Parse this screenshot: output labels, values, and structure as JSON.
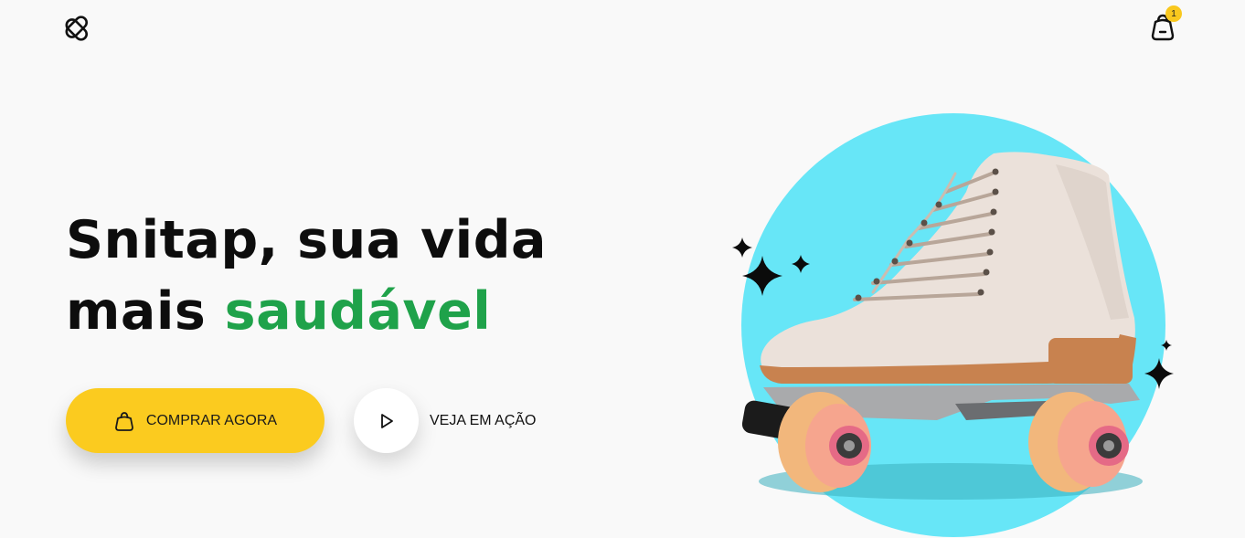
{
  "header": {
    "logo_icon": "snitap-logo-icon",
    "cart_icon": "shopping-bag-icon",
    "cart_count": "1"
  },
  "hero": {
    "title_line1": "Snitap, sua vida",
    "title_line2_plain": "mais ",
    "title_line2_accent": "saudável",
    "accent_color": "#1fa24a",
    "buy_button": {
      "label": "COMPRAR AGORA",
      "icon": "shopping-bag-icon",
      "color": "#fbcb1f"
    },
    "watch_button": {
      "label": "VEJA EM AÇÃO",
      "icon": "play-icon"
    },
    "image": {
      "subject": "roller-skate",
      "circle_color": "#67e6f7"
    }
  }
}
